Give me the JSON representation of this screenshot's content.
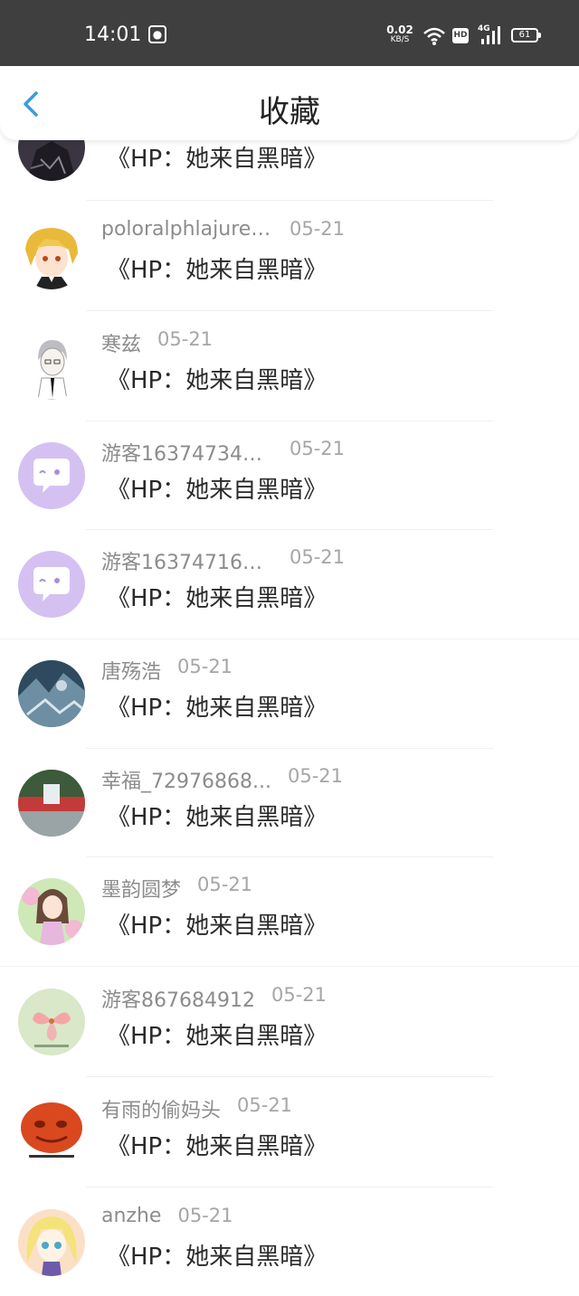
{
  "status_bar": {
    "time": "14:01",
    "net_speed": "0.02",
    "net_unit": "KB/S",
    "hd": "HD",
    "network": "4G",
    "battery": "61"
  },
  "nav": {
    "title": "收藏",
    "back_icon": "chevron-left-icon",
    "accent_color": "#3a9bdc"
  },
  "favorites": [
    {
      "user": "",
      "date": "",
      "title": "《HP：她来自黑暗》",
      "avatar": "dark-avatar"
    },
    {
      "user": "poloralphlajuren...",
      "date": "05-21",
      "title": "《HP：她来自黑暗》",
      "avatar": "blonde-anime-avatar"
    },
    {
      "user": "寒兹",
      "date": "05-21",
      "title": "《HP：她来自黑暗》",
      "avatar": "sketch-anime-avatar"
    },
    {
      "user": "游客163747345...",
      "date": "05-21",
      "title": "《HP：她来自黑暗》",
      "avatar": "guest-chat-avatar"
    },
    {
      "user": "游客163747164...",
      "date": "05-21",
      "title": "《HP：她来自黑暗》",
      "avatar": "guest-chat-avatar"
    },
    {
      "user": "唐殇浩",
      "date": "05-21",
      "title": "《HP：她来自黑暗》",
      "avatar": "blue-scene-avatar"
    },
    {
      "user": "幸福_72976868...",
      "date": "05-21",
      "title": "《HP：她来自黑暗》",
      "avatar": "fountain-photo-avatar"
    },
    {
      "user": "墨韵圆梦",
      "date": "05-21",
      "title": "《HP：她来自黑暗》",
      "avatar": "anime-girl-avatar"
    },
    {
      "user": "游客867684912",
      "date": "05-21",
      "title": "《HP：她来自黑暗》",
      "avatar": "flower-avatar"
    },
    {
      "user": "有雨的偷妈头",
      "date": "05-21",
      "title": "《HP：她来自黑暗》",
      "avatar": "orange-face-avatar"
    },
    {
      "user": "anzhe",
      "date": "05-21",
      "title": "《HP：她来自黑暗》",
      "avatar": "blonde-chibi-avatar"
    }
  ]
}
